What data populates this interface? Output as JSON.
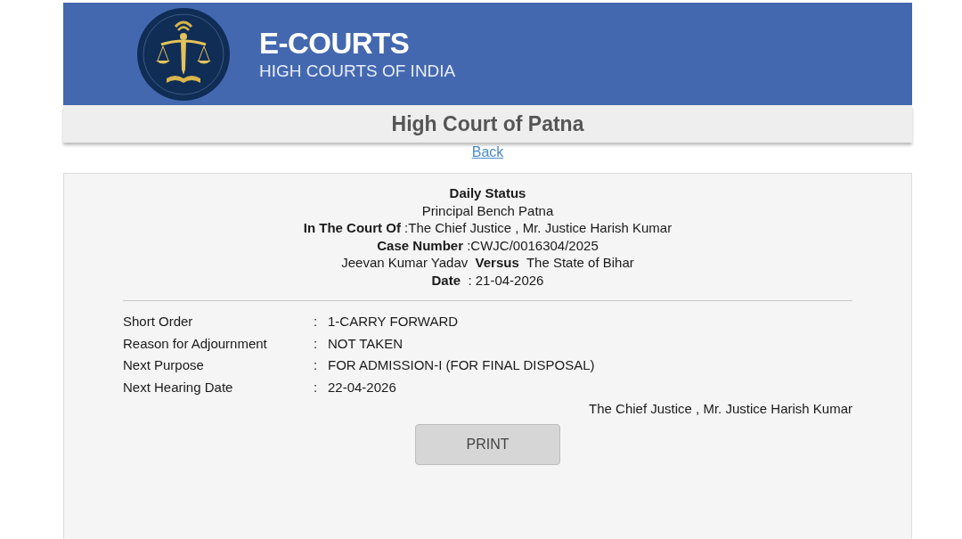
{
  "header": {
    "title": "E-COURTS",
    "subtitle": "HIGH COURTS OF INDIA"
  },
  "court_bar": {
    "title": "High Court of Patna"
  },
  "back_link": {
    "label": "Back"
  },
  "status": {
    "heading": "Daily Status",
    "lines": [
      "Principal Bench Patna",
      "**In The Court Of** :The Chief Justice , Mr. Justice Harish Kumar",
      "**Case Number** :CWJC/0016304/2025",
      "Jeevan Kumar Yadav  **Versus**  The State of Bihar",
      "**Date**  : 21-04-2026"
    ]
  },
  "details": [
    {
      "label": "Short Order",
      "separator": ":",
      "value": "1-CARRY FORWARD"
    },
    {
      "label": "Reason for Adjournment",
      "separator": ":",
      "value": "NOT TAKEN"
    },
    {
      "label": "Next Purpose",
      "separator": ":",
      "value": "FOR ADMISSION-I (FOR FINAL DISPOSAL)"
    },
    {
      "label": "Next Hearing Date",
      "separator": ":",
      "value": "22-04-2026"
    }
  ],
  "signature": "The Chief Justice , Mr. Justice Harish Kumar",
  "print_button": {
    "label": "PRINT"
  }
}
